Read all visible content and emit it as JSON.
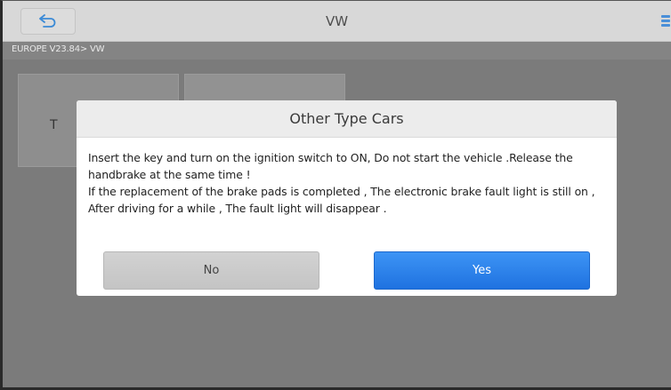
{
  "header": {
    "title": "VW",
    "back_icon": "back-arrow-icon",
    "right_icon": "menu-icon"
  },
  "breadcrumb": "EUROPE V23.84> VW",
  "background": {
    "tile_label_partial": "T"
  },
  "dialog": {
    "title": "Other Type Cars",
    "message_line1": "Insert the key and turn on the ignition switch to ON, Do not start the vehicle .Release the handbrake at the same time !",
    "message_line2": "If the replacement of the brake pads is completed , The electronic brake fault light is still on , After driving for a while , The fault light will disappear .",
    "no_label": "No",
    "yes_label": "Yes"
  },
  "colors": {
    "accent": "#2b82ee",
    "header_bg": "#d8d8d8",
    "overlay_bg": "#7b7b7b"
  }
}
